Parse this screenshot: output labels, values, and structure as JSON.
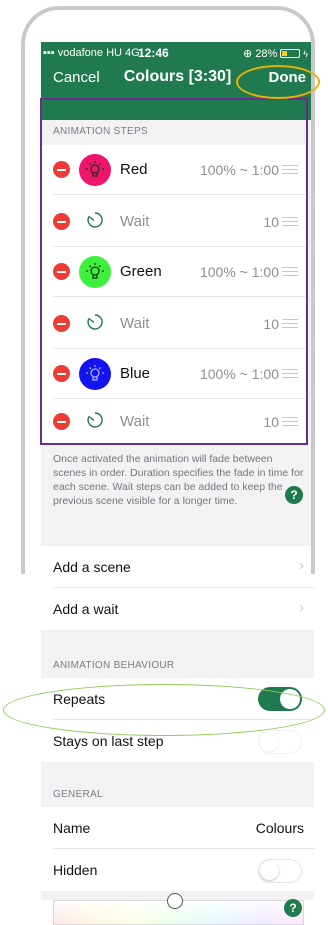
{
  "status_bar": {
    "carrier": "vodafone HU",
    "network": "4G",
    "time": "12:46",
    "battery": "28%"
  },
  "nav": {
    "cancel_label": "Cancel",
    "title": "Colours [3:30]",
    "done_label": "Done"
  },
  "animation_steps": {
    "header": "ANIMATION STEPS",
    "rows": [
      {
        "type": "scene",
        "name": "Red",
        "value": "100% ~ 1:00",
        "color": "#f0146a"
      },
      {
        "type": "wait",
        "name": "Wait",
        "value": "10"
      },
      {
        "type": "scene",
        "name": "Green",
        "value": "100% ~ 1:00",
        "color": "#3cf03c"
      },
      {
        "type": "wait",
        "name": "Wait",
        "value": "10"
      },
      {
        "type": "scene",
        "name": "Blue",
        "value": "100% ~ 1:00",
        "color": "#1414f0"
      },
      {
        "type": "wait",
        "name": "Wait",
        "value": "10"
      }
    ],
    "footnote": "Once activated the animation will fade between scenes in order. Duration specifies the fade in time for each scene. Wait steps can be added to keep the previous scene visible for a longer time."
  },
  "actions": {
    "add_scene": "Add a scene",
    "add_wait": "Add a wait"
  },
  "behaviour": {
    "header": "ANIMATION BEHAVIOUR",
    "repeats_label": "Repeats",
    "repeats_on": true,
    "stays_label": "Stays on last step",
    "stays_on": false
  },
  "general": {
    "header": "GENERAL",
    "name_label": "Name",
    "name_value": "Colours",
    "hidden_label": "Hidden",
    "hidden_on": false
  },
  "help_glyph": "?",
  "chevron_glyph": "›",
  "colors": {
    "accent": "#1f7a50",
    "delete": "#ee3b36",
    "highlight_done": "#e8b200",
    "highlight_steps": "#6a2c8f",
    "highlight_repeats": "#8fcb5a"
  }
}
